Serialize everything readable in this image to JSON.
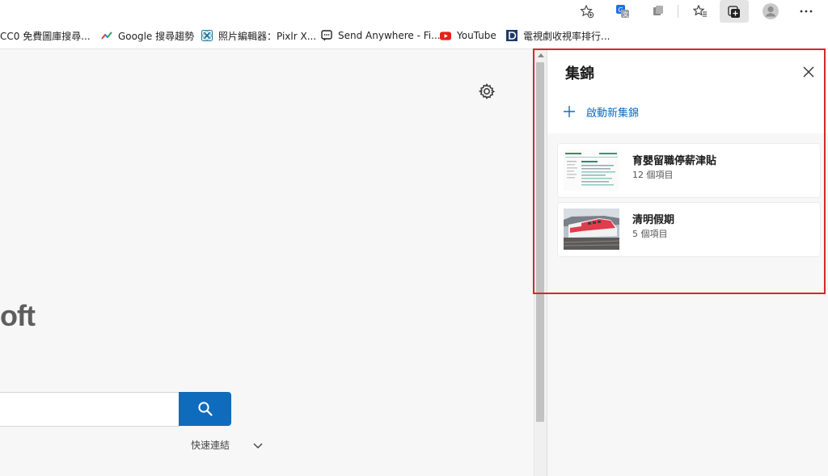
{
  "bookmarks": [
    {
      "label": "CC0 免費圖庫搜尋...",
      "icon": "cc0-favicon"
    },
    {
      "label": "Google 搜尋趨勢",
      "icon": "trends-icon"
    },
    {
      "label": "照片編輯器：Pixlr X...",
      "icon": "pixlr-icon"
    },
    {
      "label": "Send Anywhere - Fi...",
      "icon": "send-anywhere-icon"
    },
    {
      "label": "YouTube",
      "icon": "youtube-icon"
    },
    {
      "label": "電視劇收視率排行...",
      "icon": "d-logo-icon"
    }
  ],
  "page": {
    "brand_fragment": "oft",
    "quick_links_label": "快速連結"
  },
  "collections": {
    "title": "集錦",
    "new_collection_label": "啟動新集錦",
    "items": [
      {
        "title": "育嬰留職停薪津貼",
        "count": "12 個項目"
      },
      {
        "title": "清明假期",
        "count": "5 個項目"
      }
    ]
  },
  "colors": {
    "accent": "#0f6cbd",
    "highlight": "#d12a2a"
  }
}
